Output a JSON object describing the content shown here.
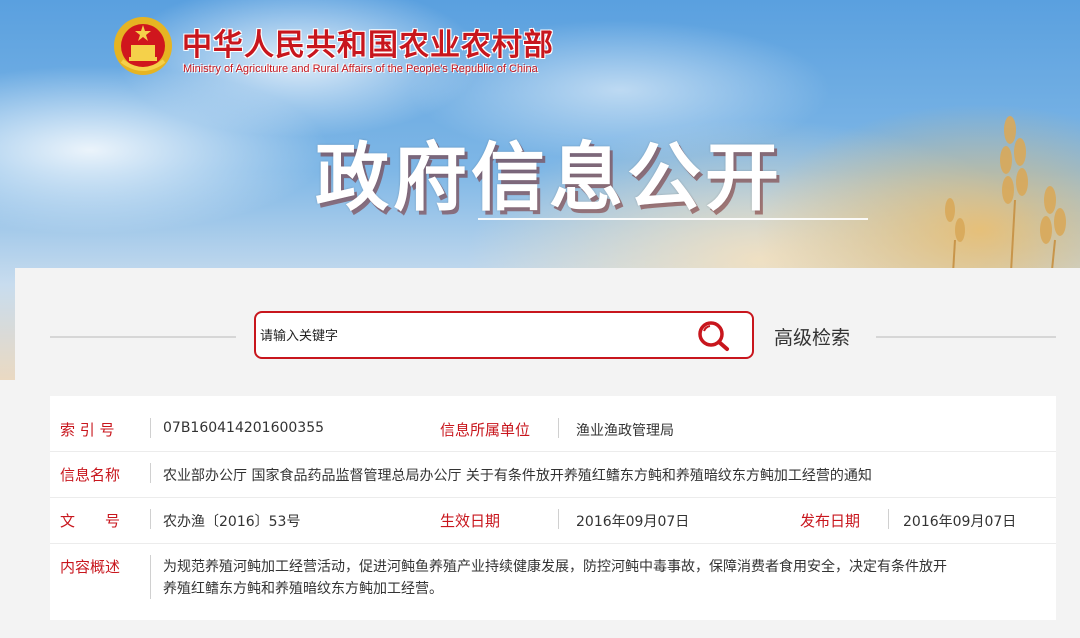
{
  "header": {
    "ministry_cn": "中华人民共和国农业农村部",
    "ministry_en": "Ministry of Agriculture and Rural Affairs of the People's Republic of China",
    "banner_title": "政府信息公开"
  },
  "search": {
    "placeholder": "请输入关键字",
    "advanced_label": "高级检索"
  },
  "info": {
    "index_label": "索 引 号",
    "index_value": "07B160414201600355",
    "unit_label": "信息所属单位",
    "unit_value": "渔业渔政管理局",
    "name_label": "信息名称",
    "name_value": "农业部办公厅 国家食品药品监督管理总局办公厅 关于有条件放开养殖红鳍东方鲀和养殖暗纹东方鲀加工经营的通知",
    "docno_label": "文　　号",
    "docno_value": "农办渔〔2016〕53号",
    "effective_label": "生效日期",
    "effective_value": "2016年09月07日",
    "publish_label": "发布日期",
    "publish_value": "2016年09月07日",
    "summary_label": "内容概述",
    "summary_line1": "为规范养殖河鲀加工经营活动，促进河鲀鱼养殖产业持续健康发展，防控河鲀中毒事故，保障消费者食用安全，决定有条件放开",
    "summary_line2": "养殖红鳍东方鲀和养殖暗纹东方鲀加工经营。"
  },
  "colors": {
    "accent": "#c8161d",
    "text": "#333333"
  },
  "icons": [
    "national-emblem-icon",
    "search-icon"
  ]
}
